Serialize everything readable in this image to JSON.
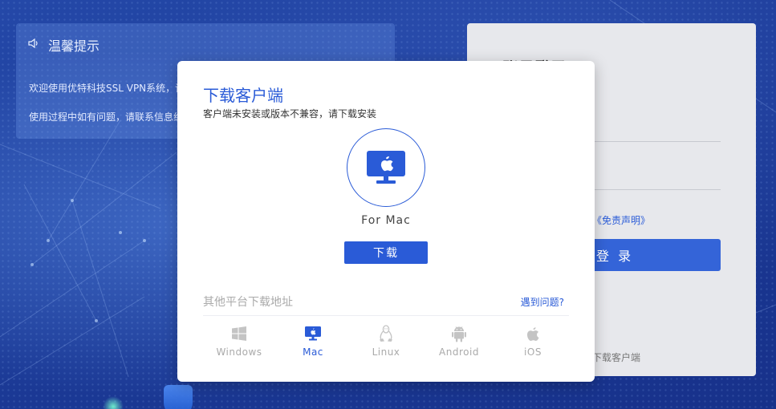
{
  "background": {
    "tip_panel": {
      "title": "温馨提示",
      "line1": "欢迎使用优特科技SSL VPN系统，请",
      "line2": "使用过程中如有问题，请联系信息组"
    },
    "login_panel": {
      "title": "账号登录",
      "disclaimer_link": "《免责声明》",
      "login_button": "登 录",
      "download_client_link": "下载客户端"
    }
  },
  "modal": {
    "title": "下载客户端",
    "subtitle": "客户端未安装或版本不兼容，请下载安装",
    "current_platform_label": "For Mac",
    "download_button": "下载",
    "other_platforms_label": "其他平台下载地址",
    "help_link": "遇到问题?",
    "platforms": [
      {
        "label": "Windows",
        "icon": "windows-icon",
        "active": false
      },
      {
        "label": "Mac",
        "icon": "mac-monitor-icon",
        "active": true
      },
      {
        "label": "Linux",
        "icon": "linux-icon",
        "active": false
      },
      {
        "label": "Android",
        "icon": "android-icon",
        "active": false
      },
      {
        "label": "iOS",
        "icon": "apple-icon",
        "active": false
      }
    ]
  },
  "colors": {
    "accent": "#2a5bd7",
    "muted": "#aaaaaa",
    "background": "#1f3d9a"
  }
}
